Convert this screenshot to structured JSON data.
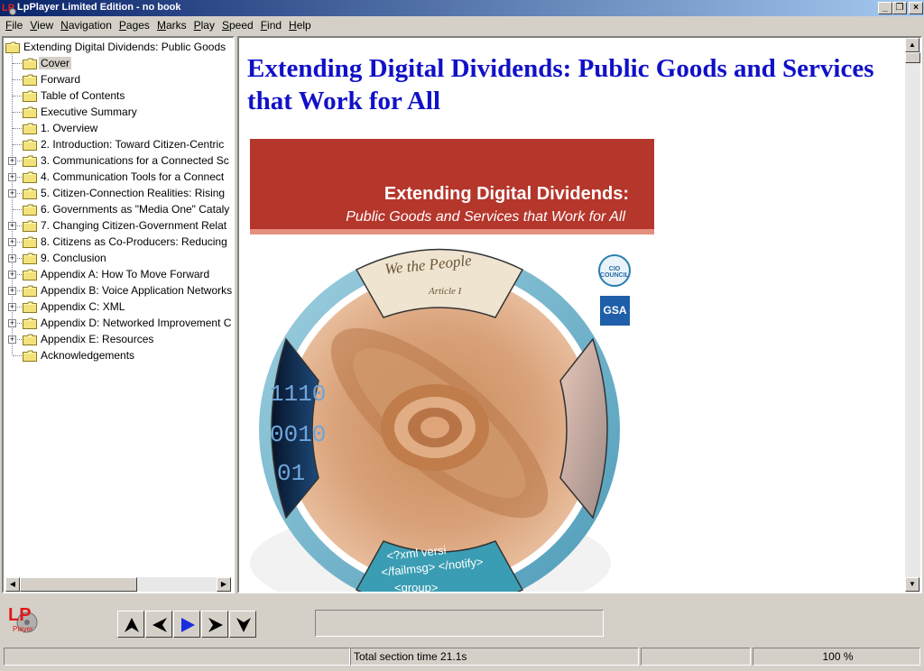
{
  "window": {
    "title": "LpPlayer Limited Edition - no book"
  },
  "menu": [
    {
      "label": "File",
      "key": "F",
      "rest": "ile"
    },
    {
      "label": "View",
      "key": "V",
      "rest": "iew"
    },
    {
      "label": "Navigation",
      "key": "N",
      "rest": "avigation"
    },
    {
      "label": "Pages",
      "key": "P",
      "rest": "ages"
    },
    {
      "label": "Marks",
      "key": "M",
      "rest": "arks"
    },
    {
      "label": "Play",
      "key": "P",
      "rest": "lay"
    },
    {
      "label": "Speed",
      "key": "S",
      "rest": "peed"
    },
    {
      "label": "Find",
      "key": "F",
      "rest": "ind"
    },
    {
      "label": "Help",
      "key": "H",
      "rest": "elp"
    }
  ],
  "tree": {
    "root": "Extending Digital Dividends: Public Goods",
    "items": [
      {
        "label": "Cover",
        "expandable": false,
        "selected": true
      },
      {
        "label": "Forward",
        "expandable": false
      },
      {
        "label": "Table of Contents",
        "expandable": false
      },
      {
        "label": "Executive Summary",
        "expandable": false
      },
      {
        "label": "1. Overview",
        "expandable": false
      },
      {
        "label": "2. Introduction: Toward Citizen-Centric",
        "expandable": false
      },
      {
        "label": "3. Communications for a Connected Sc",
        "expandable": true
      },
      {
        "label": "4. Communication Tools for a Connect",
        "expandable": true
      },
      {
        "label": "5. Citizen-Connection Realities: Rising",
        "expandable": true
      },
      {
        "label": "6. Governments as \"Media One\" Cataly",
        "expandable": false
      },
      {
        "label": "7. Changing Citizen-Government Relat",
        "expandable": true
      },
      {
        "label": "8. Citizens as Co-Producers: Reducing",
        "expandable": true
      },
      {
        "label": "9. Conclusion",
        "expandable": true
      },
      {
        "label": "Appendix A: How To Move Forward",
        "expandable": true
      },
      {
        "label": "Appendix B: Voice Application Networks",
        "expandable": true
      },
      {
        "label": "Appendix C: XML",
        "expandable": true
      },
      {
        "label": "Appendix D: Networked Improvement C",
        "expandable": true
      },
      {
        "label": "Appendix E: Resources",
        "expandable": true
      },
      {
        "label": "Acknowledgements",
        "expandable": false
      }
    ]
  },
  "content": {
    "title": "Extending Digital Dividends: Public Goods and Services that Work for All",
    "cover": {
      "title": "Extending Digital Dividends:",
      "subtitle": "Public Goods and Services that Work for All",
      "cio_logo_text": "CIO COUNCIL",
      "gsa_logo_text": "GSA",
      "scroll_text_1": "We the People",
      "scroll_text_2": "Article I",
      "xml_line_1": "<?xml versi",
      "xml_line_2": "</failmsg>  </notify>",
      "xml_line_3": "<group>",
      "binary_1": "1110",
      "binary_2": "0010",
      "binary_3": "01"
    }
  },
  "toolbar": {
    "logo_text": "LP",
    "logo_sub": "Player",
    "text_field_value": ""
  },
  "status": {
    "panel1": "",
    "section_time": "Total section time 21.1s",
    "panel3": "",
    "panel4": "",
    "zoom": "100 %"
  },
  "colors": {
    "content_title": "#1010c8",
    "cover_band": "#b5362b",
    "title_bar_start": "#0a246a",
    "title_bar_end": "#a6caf0"
  }
}
